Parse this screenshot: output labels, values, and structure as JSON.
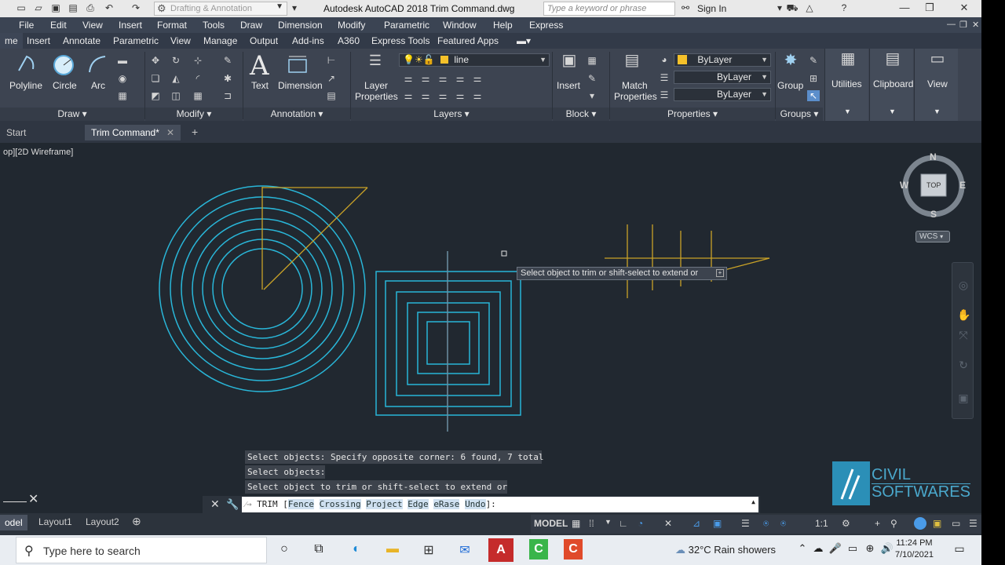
{
  "titlebar": {
    "workspace": "Drafting & Annotation",
    "title": "Autodesk AutoCAD 2018    Trim Command.dwg",
    "search_placeholder": "Type a keyword or phrase",
    "sign_in": "Sign In"
  },
  "menu": [
    "File",
    "Edit",
    "View",
    "Insert",
    "Format",
    "Tools",
    "Draw",
    "Dimension",
    "Modify",
    "Parametric",
    "Window",
    "Help",
    "Express"
  ],
  "ribbon_tabs": [
    "me",
    "Insert",
    "Annotate",
    "Parametric",
    "View",
    "Manage",
    "Output",
    "Add-ins",
    "A360",
    "Express Tools",
    "Featured Apps"
  ],
  "ribbon": {
    "draw": {
      "polyline": "Polyline",
      "circle": "Circle",
      "arc": "Arc",
      "footer": "Draw"
    },
    "modify": {
      "footer": "Modify"
    },
    "annotation": {
      "text": "Text",
      "dimension": "Dimension",
      "footer": "Annotation"
    },
    "layers": {
      "layer_properties_1": "Layer",
      "layer_properties_2": "Properties",
      "current_layer": "line",
      "footer": "Layers"
    },
    "block": {
      "insert": "Insert",
      "footer": "Block"
    },
    "properties": {
      "match_1": "Match",
      "match_2": "Properties",
      "color": "ByLayer",
      "linetype": "ByLayer",
      "lineweight": "ByLayer",
      "footer": "Properties"
    },
    "groups": {
      "group": "Group",
      "footer": "Groups"
    },
    "utilities": "Utilities",
    "clipboard": "Clipboard",
    "view": "View"
  },
  "file_tabs": {
    "start": "Start",
    "active": "Trim Command*"
  },
  "viewport": {
    "label": "op][2D Wireframe]",
    "viewcube": {
      "north": "N",
      "south": "S",
      "east": "E",
      "west": "W",
      "face": "TOP",
      "wcs": "WCS"
    }
  },
  "tooltip": "Select object to trim or shift-select to extend or",
  "command_history": [
    "Select objects: Specify opposite corner: 6 found, 7 total",
    "Select objects:",
    "Select object to trim or shift-select to extend or"
  ],
  "command_line": {
    "prefix": "TRIM [",
    "options": [
      "Fence",
      "Crossing",
      "Project",
      "Edge",
      "eRase",
      "Undo"
    ],
    "suffix": "]:"
  },
  "layout_tabs": [
    "odel",
    "Layout1",
    "Layout2"
  ],
  "status": {
    "model": "MODEL",
    "scale": "1:1"
  },
  "logo": {
    "line1": "CIVIL",
    "line2": "SOFTWARES"
  },
  "taskbar": {
    "search_placeholder": "Type here to search",
    "weather": "32°C  Rain showers",
    "time": "11:24 PM",
    "date": "7/10/2021"
  },
  "colors": {
    "drawing_cyan": "#29b6d8",
    "drawing_yellow": "#c9a227",
    "canvas": "#212830"
  }
}
